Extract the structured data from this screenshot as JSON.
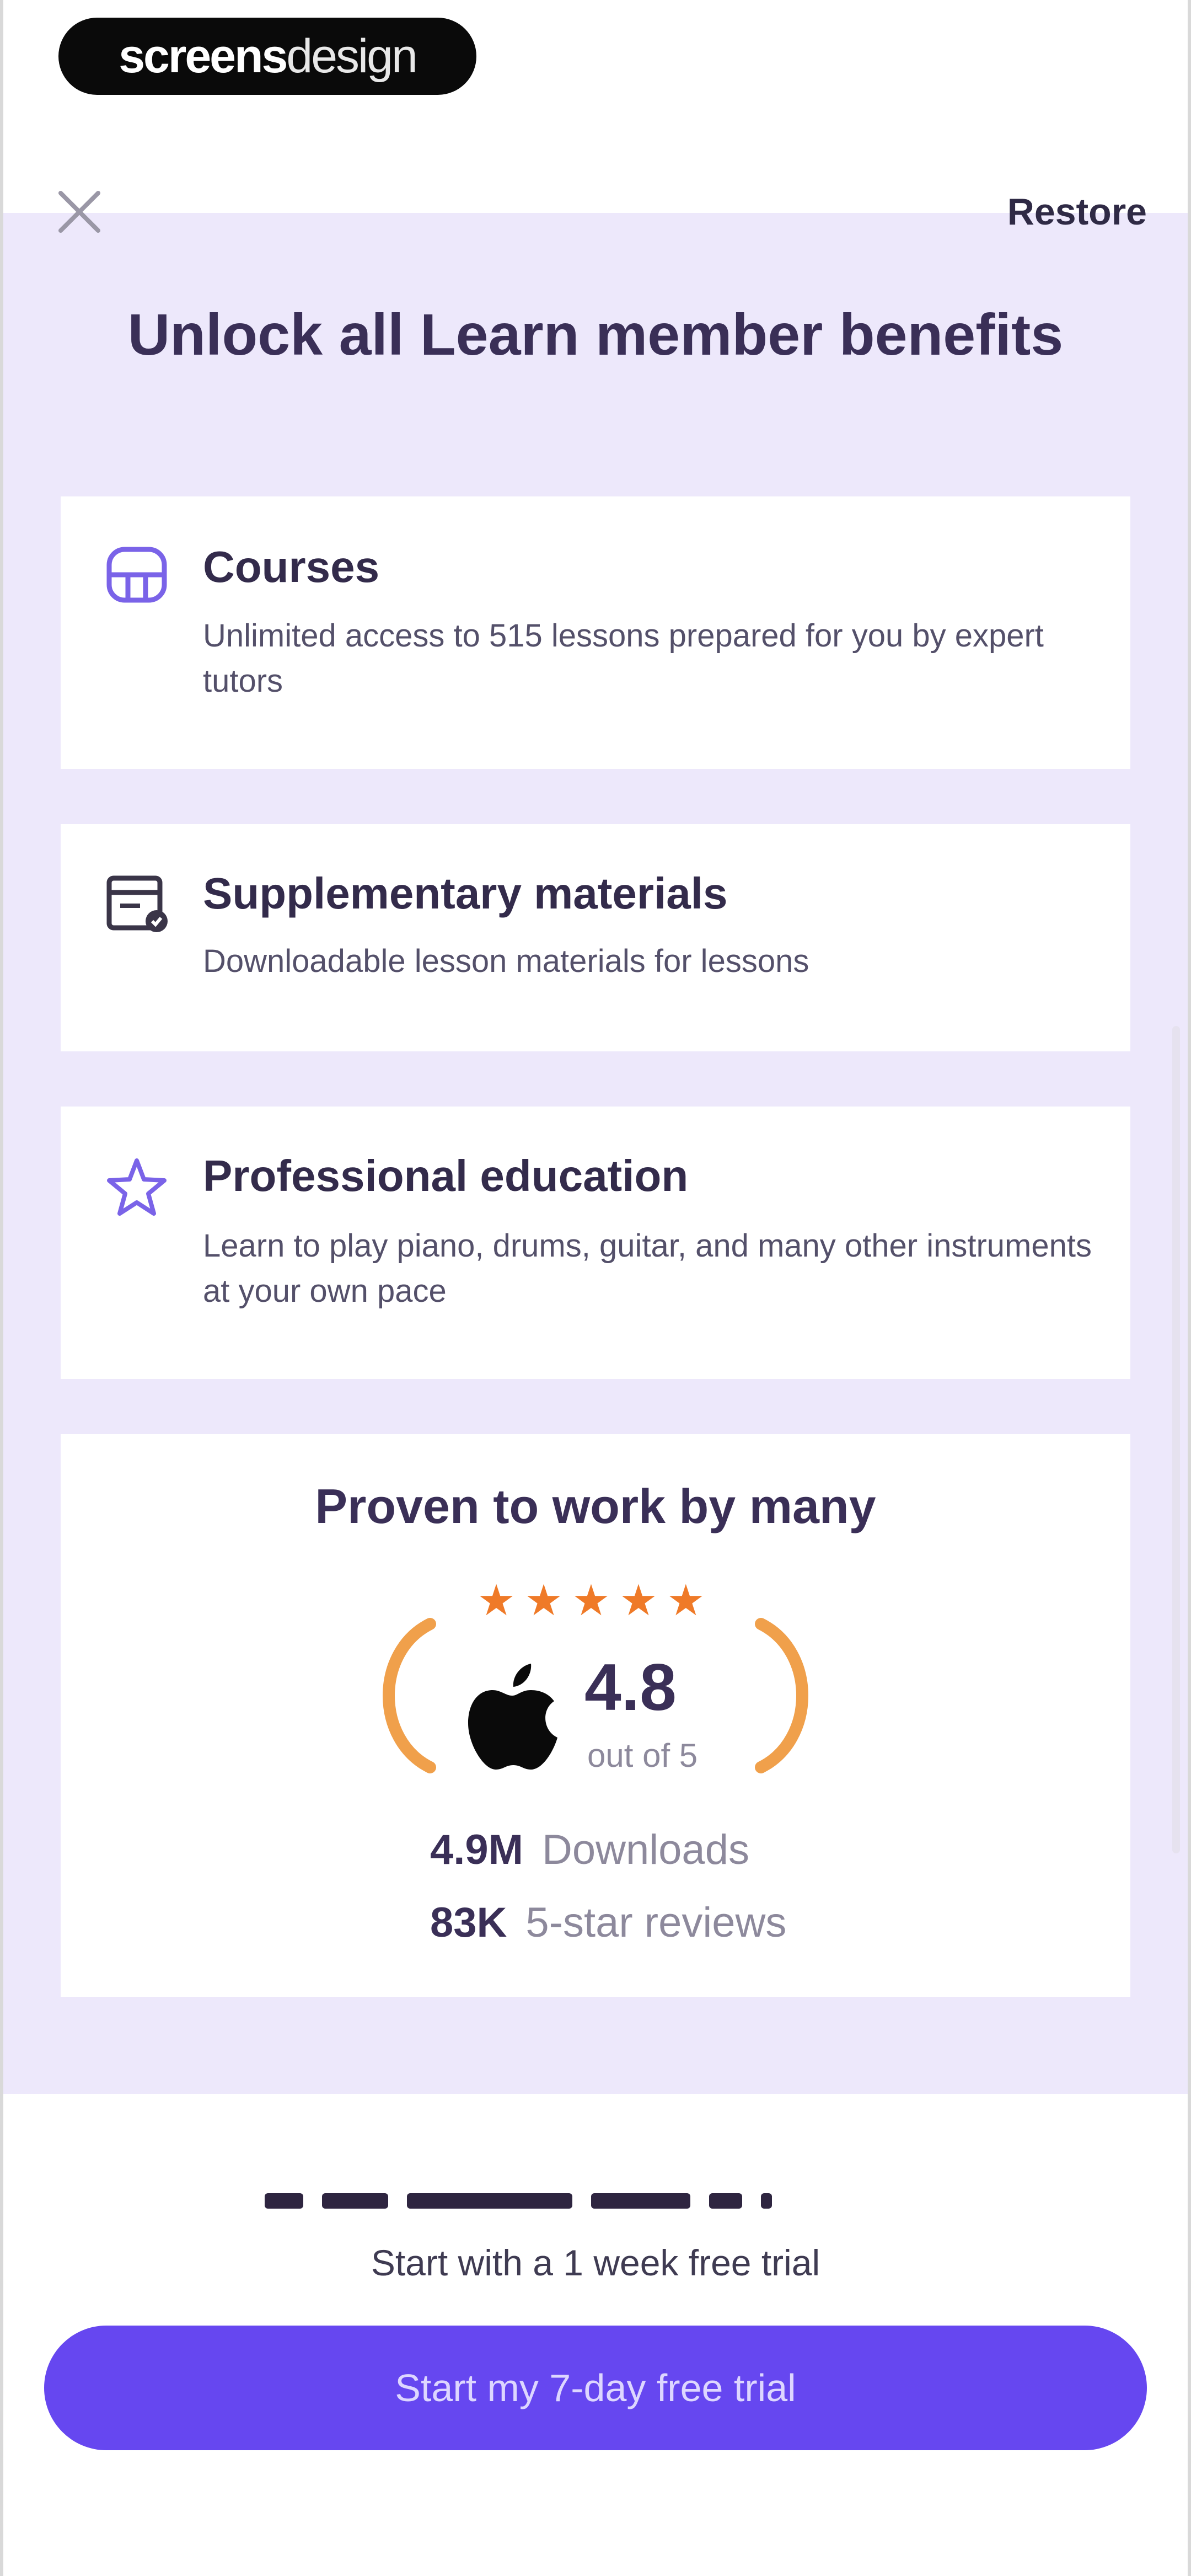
{
  "brand": {
    "part1": "screens",
    "part2": "design"
  },
  "header": {
    "restore_label": "Restore"
  },
  "headline": "Unlock all Learn member benefits",
  "benefits": [
    {
      "icon": "piano-icon",
      "title": "Courses",
      "description": "Unlimited access to 515 lessons prepared for you by expert tutors"
    },
    {
      "icon": "materials-icon",
      "title": "Supplementary materials",
      "description": "Downloadable lesson materials for lessons"
    },
    {
      "icon": "star-outline-icon",
      "title": "Professional education",
      "description": "Learn to play piano, drums, guitar, and many other instruments at your own pace"
    }
  ],
  "social_proof": {
    "title": "Proven to work by many",
    "stars": "★★★★★",
    "rating": "4.8",
    "rating_scale": "out of 5",
    "stats": [
      {
        "value": "4.9M",
        "label": "Downloads"
      },
      {
        "value": "83K",
        "label": "5-star reviews"
      }
    ]
  },
  "footer": {
    "trial_note": "Start with a 1 week free trial",
    "cta_label": "Start my 7-day free trial"
  },
  "colors": {
    "background_tint": "#ede8fb",
    "accent": "#6647f0",
    "icon_accent": "#7a63e8",
    "star": "#ef7a28",
    "laurel": "#f0a04b"
  }
}
